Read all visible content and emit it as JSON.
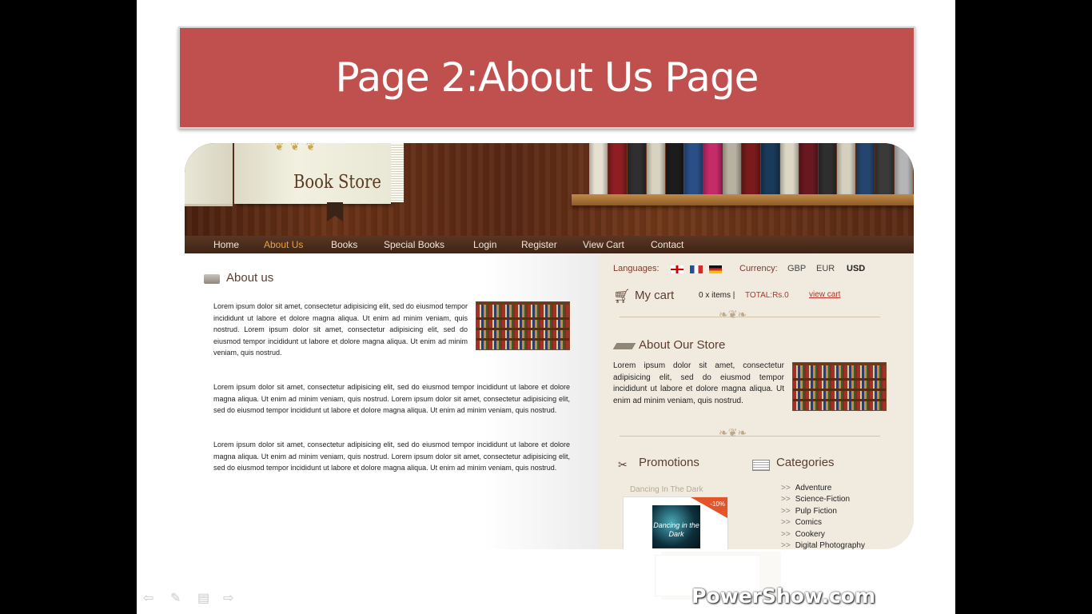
{
  "slide": {
    "title": "Page 2:About Us Page",
    "watermark": "PowerShow.com",
    "controls": [
      "arrow-left",
      "pen",
      "menu",
      "arrow-right"
    ]
  },
  "site": {
    "logo_text": "Book Store",
    "nav": [
      {
        "label": "Home",
        "active": false
      },
      {
        "label": "About Us",
        "active": true
      },
      {
        "label": "Books",
        "active": false
      },
      {
        "label": "Special Books",
        "active": false
      },
      {
        "label": "Login",
        "active": false
      },
      {
        "label": "Register",
        "active": false
      },
      {
        "label": "View Cart",
        "active": false
      },
      {
        "label": "Contact",
        "active": false
      }
    ],
    "about": {
      "heading": "About us",
      "paragraphs": [
        "Lorem ipsum dolor sit amet, consectetur adipisicing elit, sed do eiusmod tempor incididunt ut labore et dolore magna aliqua. Ut enim ad minim veniam, quis nostrud. Lorem ipsum dolor sit amet, consectetur adipisicing elit, sed do eiusmod tempor incididunt ut labore et dolore magna aliqua. Ut enim ad minim veniam, quis nostrud.",
        "Lorem ipsum dolor sit amet, consectetur adipisicing elit, sed do eiusmod tempor incididunt ut labore et dolore magna aliqua. Ut enim ad minim veniam, quis nostrud. Lorem ipsum dolor sit amet, consectetur adipisicing elit, sed do eiusmod tempor incididunt ut labore et dolore magna aliqua. Ut enim ad minim veniam, quis nostrud.",
        "Lorem ipsum dolor sit amet, consectetur adipisicing elit, sed do eiusmod tempor incididunt ut labore et dolore magna aliqua. Ut enim ad minim veniam, quis nostrud. Lorem ipsum dolor sit amet, consectetur adipisicing elit, sed do eiusmod tempor incididunt ut labore et dolore magna aliqua. Ut enim ad minim veniam, quis nostrud."
      ]
    },
    "sidebar": {
      "languages_label": "Languages:",
      "currency_label": "Currency:",
      "currencies": [
        "GBP",
        "EUR",
        "USD"
      ],
      "cart_title": "My cart",
      "cart_items": "0 x items |",
      "cart_total": "TOTAL:Rs.0",
      "view_cart": "view cart",
      "about_store_title": "About Our Store",
      "about_store_text": "Lorem ipsum dolor sit amet, consectetur adipisicing elit, sed do eiusmod tempor incididunt ut labore et dolore magna aliqua. Ut enim ad minim veniam, quis nostrud.",
      "promotions_title": "Promotions",
      "promo_book_name": "Dancing In The Dark",
      "promo_cover_text": "Dancing in the Dark",
      "promo_badge": "-10%",
      "categories_title": "Categories",
      "categories": [
        "Adventure",
        "Science-Fiction",
        "Pulp Fiction",
        "Comics",
        "Cookery",
        "Digital Photography"
      ]
    }
  }
}
